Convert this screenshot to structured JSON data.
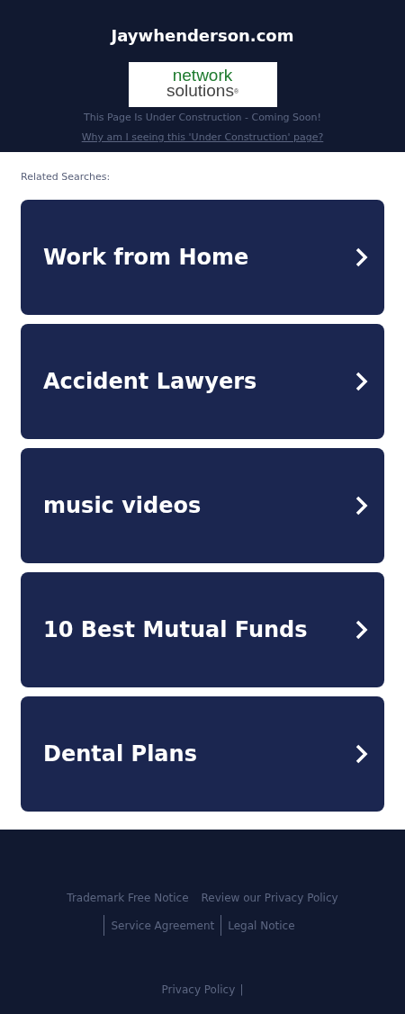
{
  "header": {
    "domain": "Jaywhenderson.com",
    "logo": {
      "line_1": "network",
      "line_2": "solutions",
      "mark": "®"
    },
    "notice": "This Page Is Under Construction - Coming Soon!",
    "notice_link": "Why am I seeing this 'Under Construction' page?"
  },
  "related": {
    "label": "Related Searches:",
    "items": [
      {
        "text": "Work from Home"
      },
      {
        "text": "Accident Lawyers"
      },
      {
        "text": "music videos"
      },
      {
        "text": "10 Best Mutual Funds"
      },
      {
        "text": "Dental Plans"
      }
    ]
  },
  "footer": {
    "links": [
      {
        "text": "Trademark Free Notice",
        "divider_before": false
      },
      {
        "text": "Review our Privacy Policy",
        "divider_before": false
      },
      {
        "text": "Service Agreement",
        "divider_before": true
      },
      {
        "text": "Legal Notice",
        "divider_before": true
      }
    ],
    "bottom_link": "Privacy Policy",
    "bottom_separator": "|"
  }
}
